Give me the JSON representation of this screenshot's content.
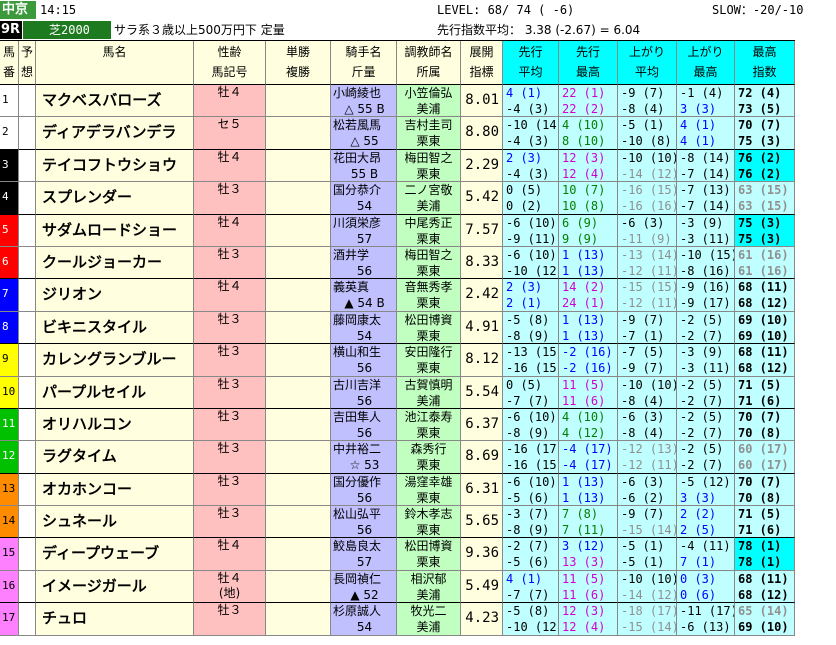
{
  "header": {
    "venue": "中京",
    "time": "14:15",
    "race_no": "9R",
    "course": "芝2000",
    "race_name": "サラ系３歳以上500万円下 定量",
    "level": "LEVEL: 68/ 74 ( -6)",
    "slow": "SLOW：-20/-10",
    "pace_avg": "先行指数平均： 3.38 (-2.67) = 6.04"
  },
  "columns": [
    {
      "l1": "馬",
      "l2": "番"
    },
    {
      "l1": "予",
      "l2": "想"
    },
    {
      "l1": "馬名",
      "l2": ""
    },
    {
      "l1": "性齢",
      "l2": "馬記号"
    },
    {
      "l1": "単勝",
      "l2": "複勝"
    },
    {
      "l1": "騎手名",
      "l2": "斤量"
    },
    {
      "l1": "調教師名",
      "l2": "所属"
    },
    {
      "l1": "展開",
      "l2": "指標"
    },
    {
      "l1": "先行",
      "l2": "平均"
    },
    {
      "l1": "先行",
      "l2": "最高"
    },
    {
      "l1": "上がり",
      "l2": "平均"
    },
    {
      "l1": "上がり",
      "l2": "最高"
    },
    {
      "l1": "最高",
      "l2": "指数"
    }
  ],
  "rows": [
    {
      "no": "1",
      "name": "マクベスバローズ",
      "sex": "牡４",
      "sex2": "",
      "jockey": "小崎綾也",
      "weight": "△ 55 B",
      "trainer": "小笠倫弘",
      "belong": "美浦",
      "idx": "8.01",
      "a1": "4 (1)",
      "a2": "-4 (3)",
      "b1": "22 (1)",
      "b2": "22 (2)",
      "c1": "-9 (7)",
      "c2": "-8 (4)",
      "d1": "-1 (4)",
      "d2": "3 (3)",
      "e1": "72 (4)",
      "e2": "73 (5)"
    },
    {
      "no": "2",
      "name": "ディアデラバンデラ",
      "sex": "セ５",
      "sex2": "",
      "jockey": "松若風馬",
      "weight": "△ 55",
      "trainer": "吉村圭司",
      "belong": "栗東",
      "idx": "8.80",
      "a1": "-10 (14)",
      "a2": "-4 (3)",
      "b1": "4 (10)",
      "b2": "8 (10)",
      "c1": "-5 (1)",
      "c2": "-10 (8)",
      "d1": "4 (1)",
      "d2": "4 (1)",
      "e1": "70 (7)",
      "e2": "75 (3)"
    },
    {
      "no": "3",
      "name": "テイコフトウショウ",
      "sex": "牡４",
      "sex2": "",
      "jockey": "花田大昂",
      "weight": "55 B",
      "trainer": "梅田智之",
      "belong": "栗東",
      "idx": "2.29",
      "a1": "2 (3)",
      "a2": "-4 (3)",
      "b1": "12 (3)",
      "b2": "12 (4)",
      "c1": "-10 (10)",
      "c2": "-14 (12)",
      "d1": "-8 (14)",
      "d2": "-7 (14)",
      "e1": "76 (2)",
      "e2": "76 (2)"
    },
    {
      "no": "4",
      "name": "スプレンダー",
      "sex": "牡３",
      "sex2": "",
      "jockey": "国分恭介",
      "weight": "54",
      "trainer": "二ノ宮敬",
      "belong": "美浦",
      "idx": "5.42",
      "a1": "0 (5)",
      "a2": "0 (2)",
      "b1": "10 (7)",
      "b2": "10 (8)",
      "c1": "-16 (15)",
      "c2": "-16 (16)",
      "d1": "-7 (13)",
      "d2": "-7 (14)",
      "e1": "63 (15)",
      "e2": "63 (15)"
    },
    {
      "no": "5",
      "name": "サダムロードショー",
      "sex": "牡４",
      "sex2": "",
      "jockey": "川須栄彦",
      "weight": "57",
      "trainer": "中尾秀正",
      "belong": "栗東",
      "idx": "7.57",
      "a1": "-6 (10)",
      "a2": "-9 (11)",
      "b1": "6 (9)",
      "b2": "9 (9)",
      "c1": "-6 (3)",
      "c2": "-11 (9)",
      "d1": "-3 (9)",
      "d2": "-3 (11)",
      "e1": "75 (3)",
      "e2": "75 (3)"
    },
    {
      "no": "6",
      "name": "クールジョーカー",
      "sex": "牡３",
      "sex2": "",
      "jockey": "酒井学",
      "weight": "56",
      "trainer": "梅田智之",
      "belong": "栗東",
      "idx": "8.33",
      "a1": "-6 (10)",
      "a2": "-10 (12)",
      "b1": "1 (13)",
      "b2": "1 (13)",
      "c1": "-13 (14)",
      "c2": "-12 (11)",
      "d1": "-10 (15)",
      "d2": "-8 (16)",
      "e1": "61 (16)",
      "e2": "61 (16)"
    },
    {
      "no": "7",
      "name": "ジリオン",
      "sex": "牡４",
      "sex2": "",
      "jockey": "義英真",
      "weight": "▲ 54 B",
      "trainer": "音無秀孝",
      "belong": "栗東",
      "idx": "2.42",
      "a1": "2 (3)",
      "a2": "2 (1)",
      "b1": "14 (2)",
      "b2": "24 (1)",
      "c1": "-15 (15)",
      "c2": "-12 (11)",
      "d1": "-9 (16)",
      "d2": "-9 (17)",
      "e1": "68 (11)",
      "e2": "68 (12)"
    },
    {
      "no": "8",
      "name": "ビキニスタイル",
      "sex": "牡３",
      "sex2": "",
      "jockey": "藤岡康太",
      "weight": "54",
      "trainer": "松田博資",
      "belong": "栗東",
      "idx": "4.91",
      "a1": "-5 (8)",
      "a2": "-8 (9)",
      "b1": "1 (13)",
      "b2": "1 (13)",
      "c1": "-9 (7)",
      "c2": "-7 (1)",
      "d1": "-2 (5)",
      "d2": "-2 (7)",
      "e1": "69 (10)",
      "e2": "69 (10)"
    },
    {
      "no": "9",
      "name": "カレングランブルー",
      "sex": "牡３",
      "sex2": "",
      "jockey": "横山和生",
      "weight": "56",
      "trainer": "安田隆行",
      "belong": "栗東",
      "idx": "8.12",
      "a1": "-13 (15)",
      "a2": "-16 (15)",
      "b1": "-2 (16)",
      "b2": "-2 (16)",
      "c1": "-7 (5)",
      "c2": "-9 (7)",
      "d1": "-3 (9)",
      "d2": "-3 (11)",
      "e1": "68 (11)",
      "e2": "68 (12)"
    },
    {
      "no": "10",
      "name": "パープルセイル",
      "sex": "牡３",
      "sex2": "",
      "jockey": "古川吉洋",
      "weight": "56",
      "trainer": "古賀慎明",
      "belong": "美浦",
      "idx": "5.54",
      "a1": "0 (5)",
      "a2": "-7 (7)",
      "b1": "11 (5)",
      "b2": "11 (6)",
      "c1": "-10 (10)",
      "c2": "-8 (4)",
      "d1": "-2 (5)",
      "d2": "-2 (7)",
      "e1": "71 (5)",
      "e2": "71 (6)"
    },
    {
      "no": "11",
      "name": "オリハルコン",
      "sex": "牡３",
      "sex2": "",
      "jockey": "吉田隼人",
      "weight": "56",
      "trainer": "池江泰寿",
      "belong": "栗東",
      "idx": "6.37",
      "a1": "-6 (10)",
      "a2": "-8 (9)",
      "b1": "4 (10)",
      "b2": "4 (12)",
      "c1": "-6 (3)",
      "c2": "-8 (4)",
      "d1": "-2 (5)",
      "d2": "-2 (7)",
      "e1": "70 (7)",
      "e2": "70 (8)"
    },
    {
      "no": "12",
      "name": "ラグタイム",
      "sex": "牡３",
      "sex2": "",
      "jockey": "中井裕二",
      "weight": "☆ 53",
      "trainer": "森秀行",
      "belong": "栗東",
      "idx": "8.69",
      "a1": "-16 (17)",
      "a2": "-16 (15)",
      "b1": "-4 (17)",
      "b2": "-4 (17)",
      "c1": "-12 (13)",
      "c2": "-12 (11)",
      "d1": "-2 (5)",
      "d2": "-2 (7)",
      "e1": "60 (17)",
      "e2": "60 (17)"
    },
    {
      "no": "13",
      "name": "オカホンコー",
      "sex": "牡３",
      "sex2": "",
      "jockey": "国分優作",
      "weight": "56",
      "trainer": "湯窪幸雄",
      "belong": "栗東",
      "idx": "6.31",
      "a1": "-6 (10)",
      "a2": "-5 (6)",
      "b1": "1 (13)",
      "b2": "1 (13)",
      "c1": "-6 (3)",
      "c2": "-6 (2)",
      "d1": "-5 (12)",
      "d2": "3 (3)",
      "e1": "70 (7)",
      "e2": "70 (8)"
    },
    {
      "no": "14",
      "name": "シュネール",
      "sex": "牡３",
      "sex2": "",
      "jockey": "松山弘平",
      "weight": "56",
      "trainer": "鈴木孝志",
      "belong": "栗東",
      "idx": "5.65",
      "a1": "-3 (7)",
      "a2": "-8 (9)",
      "b1": "7 (8)",
      "b2": "7 (11)",
      "c1": "-9 (7)",
      "c2": "-15 (14)",
      "d1": "2 (2)",
      "d2": "2 (5)",
      "e1": "71 (5)",
      "e2": "71 (6)"
    },
    {
      "no": "15",
      "name": "ディープウェーブ",
      "sex": "牡４",
      "sex2": "",
      "jockey": "鮫島良太",
      "weight": "57",
      "trainer": "松田博資",
      "belong": "栗東",
      "idx": "9.36",
      "a1": "-2 (7)",
      "a2": "-5 (6)",
      "b1": "3 (12)",
      "b2": "13 (3)",
      "c1": "-5 (1)",
      "c2": "-5 (1)",
      "d1": "-4 (11)",
      "d2": "7 (1)",
      "e1": "78 (1)",
      "e2": "78 (1)"
    },
    {
      "no": "16",
      "name": "イメージガール",
      "sex": "牡４",
      "sex2": "(地)",
      "jockey": "長岡禎仁",
      "weight": "▲ 52",
      "trainer": "相沢郁",
      "belong": "美浦",
      "idx": "5.49",
      "a1": "4 (1)",
      "a2": "-7 (7)",
      "b1": "11 (5)",
      "b2": "11 (6)",
      "c1": "-10 (10)",
      "c2": "-14 (12)",
      "d1": "0 (3)",
      "d2": "0 (6)",
      "e1": "68 (11)",
      "e2": "68 (12)"
    },
    {
      "no": "17",
      "name": "チュロ",
      "sex": "牡３",
      "sex2": "",
      "jockey": "杉原誠人",
      "weight": "54",
      "trainer": "牧光二",
      "belong": "美浦",
      "idx": "4.23",
      "a1": "-5 (8)",
      "a2": "-10 (12)",
      "b1": "12 (3)",
      "b2": "12 (4)",
      "c1": "-18 (17)",
      "c2": "-15 (14)",
      "d1": "-11 (17)",
      "d2": "-6 (13)",
      "e1": "65 (14)",
      "e2": "69 (10)"
    }
  ],
  "frame_colors": [
    "#ffffff",
    "#ffffff",
    "#000000",
    "#000000",
    "#ff0000",
    "#ff0000",
    "#0000ff",
    "#0000ff",
    "#ffff00",
    "#ffff00",
    "#00c000",
    "#00c000",
    "#ff8c00",
    "#ff8c00",
    "#ff80ff",
    "#ff80ff",
    "#ff80ff"
  ]
}
